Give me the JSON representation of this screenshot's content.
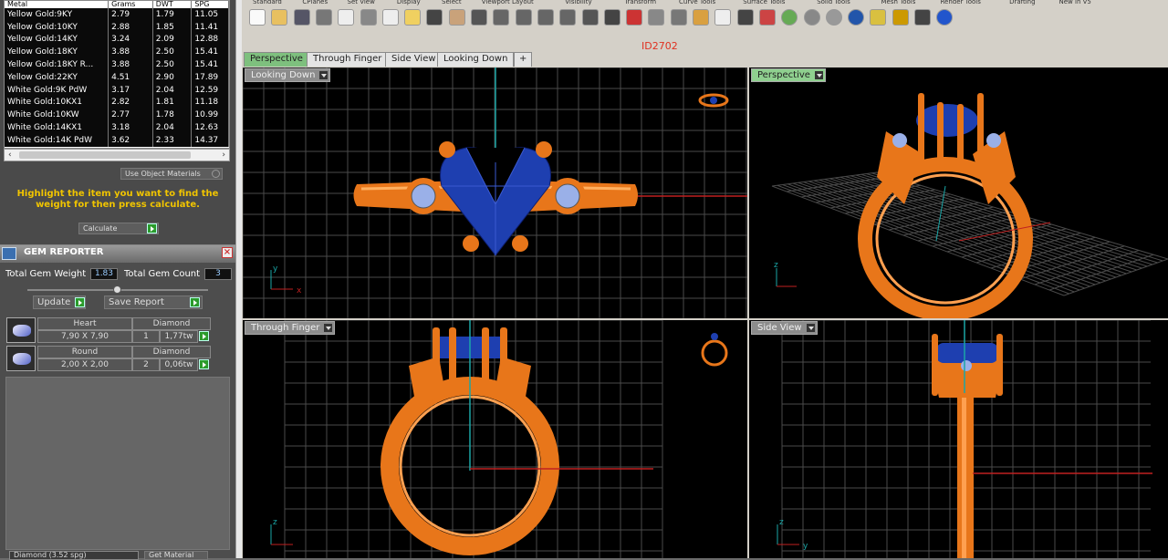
{
  "metal_table": {
    "headers": [
      "Metal",
      "Grams",
      "DWT",
      "SPG"
    ],
    "rows": [
      [
        "Yellow Gold:9KY",
        "2.79",
        "1.79",
        "11.05"
      ],
      [
        "Yellow Gold:10KY",
        "2.88",
        "1.85",
        "11.41"
      ],
      [
        "Yellow Gold:14KY",
        "3.24",
        "2.09",
        "12.88"
      ],
      [
        "Yellow Gold:18KY",
        "3.88",
        "2.50",
        "15.41"
      ],
      [
        "Yellow Gold:18KY R...",
        "3.88",
        "2.50",
        "15.41"
      ],
      [
        "Yellow Gold:22KY",
        "4.51",
        "2.90",
        "17.89"
      ],
      [
        "White Gold:9K PdW",
        "3.17",
        "2.04",
        "12.59"
      ],
      [
        "White Gold:10KX1",
        "2.82",
        "1.81",
        "11.18"
      ],
      [
        "White Gold:10KW",
        "2.77",
        "1.78",
        "10.99"
      ],
      [
        "White Gold:14KX1",
        "3.18",
        "2.04",
        "12.63"
      ],
      [
        "White Gold:14K PdW",
        "3.62",
        "2.33",
        "14.37"
      ]
    ]
  },
  "use_object_materials": "Use Object Materials",
  "highlight_text": "Highlight the item you want to find the weight for then press calculate.",
  "calculate_label": "Calculate",
  "gem_reporter": {
    "title": "GEM REPORTER",
    "total_weight_label": "Total Gem Weight",
    "total_weight_value": "1.83",
    "total_count_label": "Total Gem Count",
    "total_count_value": "3",
    "update_label": "Update",
    "save_label": "Save Report",
    "gems": [
      {
        "shape": "Heart",
        "type": "Diamond",
        "size": "7,90 X 7,90",
        "count": "1",
        "weight": "1,77tw"
      },
      {
        "shape": "Round",
        "type": "Diamond",
        "size": "2,00 X 2,00",
        "count": "2",
        "weight": "0,06tw"
      }
    ],
    "material_select": "Diamond    (3.52 spg)",
    "get_material": "Get Material"
  },
  "ribbon_tabs": [
    "Standard",
    "CPlanes",
    "Set View",
    "Display",
    "Select",
    "Viewport Layout",
    "Visibility",
    "Transform",
    "Curve Tools",
    "Surface Tools",
    "Solid Tools",
    "Mesh Tools",
    "Render Tools",
    "Drafting",
    "New in V5"
  ],
  "document_id": "ID2702",
  "view_tabs": [
    "Perspective",
    "Through Finger",
    "Side View",
    "Looking Down",
    "+"
  ],
  "viewports": {
    "top_left": "Looking Down",
    "top_right": "Perspective",
    "bottom_left": "Through Finger",
    "bottom_right": "Side View"
  },
  "axis_labels": {
    "x": "x",
    "y": "y",
    "z": "z"
  },
  "colors": {
    "metal": "#e8761a",
    "gem": "#1e3fb0",
    "grid": "#555555",
    "active_tab": "#7ec07e"
  }
}
